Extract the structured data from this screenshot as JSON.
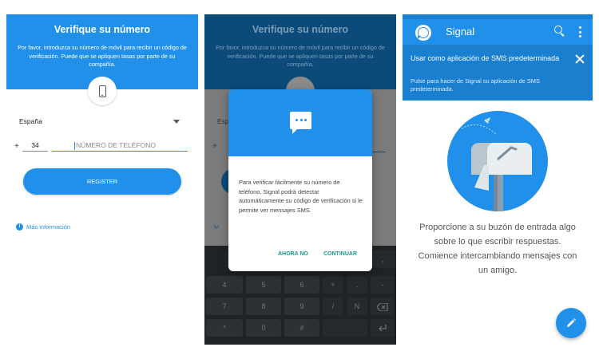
{
  "screen1": {
    "title": "Verifique su número",
    "description": "Por favor, introduzca su número de móvil para recibir un código de verificación. Puede que se apliquen tasas por parte de su compañía.",
    "country": "España",
    "plus": "+",
    "country_code": "34",
    "phone_placeholder": "NÚMERO DE TELÉFONO",
    "register_label": "REGISTER",
    "more_info_label": "Más información",
    "accent_color": "#2090ea"
  },
  "screen2": {
    "title": "Verifique su número",
    "description": "Por favor, introduzca su número de móvil para recibir un código de verificación. Puede que se apliquen tasas por parte de su compañía.",
    "country_partial": "Espa",
    "plus": "+",
    "more_partial": "M",
    "dialog": {
      "text": "Para verificar fácilmente su número de teléfono, Signal podrá detectar automáticamente su código de verificación si le permite ver mensajes SMS.",
      "not_now_label": "AHORA NO",
      "continue_label": "CONTINUAR"
    },
    "keyboard_keys": [
      ",",
      "4",
      "5",
      "6",
      "+",
      ".",
      "-",
      "7",
      "8",
      "9",
      "/",
      "N",
      "*",
      "0",
      "#",
      "."
    ]
  },
  "screen3": {
    "app_title": "Signal",
    "icons": [
      "signal-logo-icon",
      "search-icon",
      "more-vert-icon",
      "close-icon",
      "mailbox-icon",
      "pencil-icon"
    ],
    "banner": {
      "title": "Usar como aplicación de SMS predeterminada",
      "subtitle": "Pulse para hacer de Signal su aplicación de SMS predeterminada."
    },
    "empty_message": "Proporcione a su buzón de entrada algo sobre lo que escribir respuestas. Comience intercambiando mensajes con un amigo."
  }
}
